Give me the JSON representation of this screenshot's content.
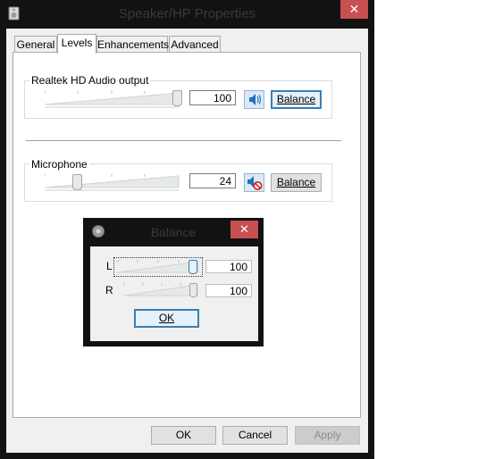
{
  "window": {
    "title": "Speaker/HP Properties",
    "close_glyph": "✕",
    "icon": "speaker-icon"
  },
  "tabs": [
    {
      "label": "General",
      "active": false
    },
    {
      "label": "Levels",
      "active": true
    },
    {
      "label": "Enhancements",
      "active": false
    },
    {
      "label": "Advanced",
      "active": false
    }
  ],
  "levels": {
    "output": {
      "label": "Realtek HD Audio output",
      "value": "100",
      "level": 1.0,
      "mute_icon": "speaker-on-icon",
      "balance_label": "Balance",
      "balance_focused": true
    },
    "microphone": {
      "label": "Microphone",
      "value": "24",
      "level": 0.24,
      "mute_icon": "speaker-muted-icon",
      "balance_label": "Balance"
    }
  },
  "footer": {
    "ok": "OK",
    "cancel": "Cancel",
    "apply": "Apply"
  },
  "balance_dialog": {
    "title": "Balance",
    "close_glyph": "✕",
    "channels": [
      {
        "label": "L",
        "value": "100",
        "level": 1.0,
        "focused": true
      },
      {
        "label": "R",
        "value": "100",
        "level": 1.0,
        "focused": false
      }
    ],
    "ok": "OK"
  },
  "colors": {
    "title_bar": "#121212",
    "close_button": "#c75050",
    "focus_border": "#3c7fb1",
    "icon_blue": "#1e73be",
    "mute_red": "#d31c1c"
  }
}
